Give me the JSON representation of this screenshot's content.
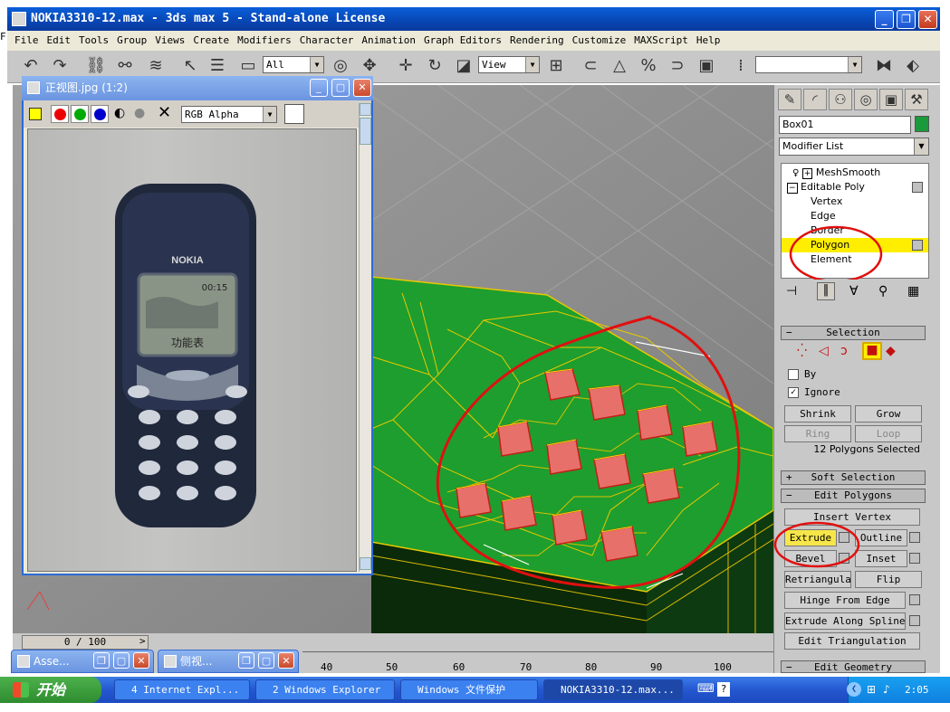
{
  "app": {
    "title": "NOKIA3310-12.max - 3ds max 5 - Stand-alone License",
    "left_cutoff_letter": "F"
  },
  "menu": [
    "File",
    "Edit",
    "Tools",
    "Group",
    "Views",
    "Create",
    "Modifiers",
    "Character",
    "Animation",
    "Graph Editors",
    "Rendering",
    "Customize",
    "MAXScript",
    "Help"
  ],
  "toolbar": {
    "selection_filter": "All",
    "ref_coord": "View",
    "named_selection": ""
  },
  "image_window": {
    "title": "正视图.jpg (1:2)",
    "channel": "RGB Alpha",
    "phone_brand": "NOKIA",
    "phone_time": "00:15",
    "phone_label": "功能表"
  },
  "command_panel": {
    "object_name": "Box01",
    "object_color": "#1a9a3a",
    "modifier_list": "Modifier List",
    "stack": [
      {
        "label": "MeshSmooth",
        "level": 0
      },
      {
        "label": "Editable Poly",
        "level": 0
      },
      {
        "label": "Vertex",
        "level": 1
      },
      {
        "label": "Edge",
        "level": 1
      },
      {
        "label": "Border",
        "level": 1
      },
      {
        "label": "Polygon",
        "level": 1,
        "selected": true
      },
      {
        "label": "Element",
        "level": 1
      }
    ],
    "selection": {
      "rollout": "Selection",
      "by": "By",
      "ignore": "Ignore",
      "shrink": "Shrink",
      "grow": "Grow",
      "ring": "Ring",
      "loop": "Loop",
      "status": "12 Polygons Selected"
    },
    "soft_selection": "Soft Selection",
    "edit_polygons": {
      "rollout": "Edit Polygons",
      "insert_vertex": "Insert Vertex",
      "extrude": "Extrude",
      "outline": "Outline",
      "bevel": "Bevel",
      "inset": "Inset",
      "retriangulate": "Retriangulate",
      "flip": "Flip",
      "hinge": "Hinge From Edge",
      "extrude_spline": "Extrude Along Spline",
      "edit_tri": "Edit Triangulation"
    },
    "edit_geometry": "Edit Geometry"
  },
  "timeline": {
    "frame": "0 / 100",
    "ticks": [
      "40",
      "50",
      "60",
      "70",
      "80",
      "90",
      "100"
    ]
  },
  "minimized": [
    {
      "label": "Asse..."
    },
    {
      "label": "侧视..."
    }
  ],
  "taskbar": {
    "start": "开始",
    "tasks": [
      "4 Internet Expl...",
      "2 Windows Explorer",
      "Windows 文件保护",
      "NOKIA3310-12.max..."
    ],
    "clock": "2:05"
  },
  "colors": {
    "model_green": "#1e9e2e",
    "highlight_yellow": "#ffee00",
    "annotation_red": "#e01010",
    "extrude_face": "#e8706a"
  }
}
